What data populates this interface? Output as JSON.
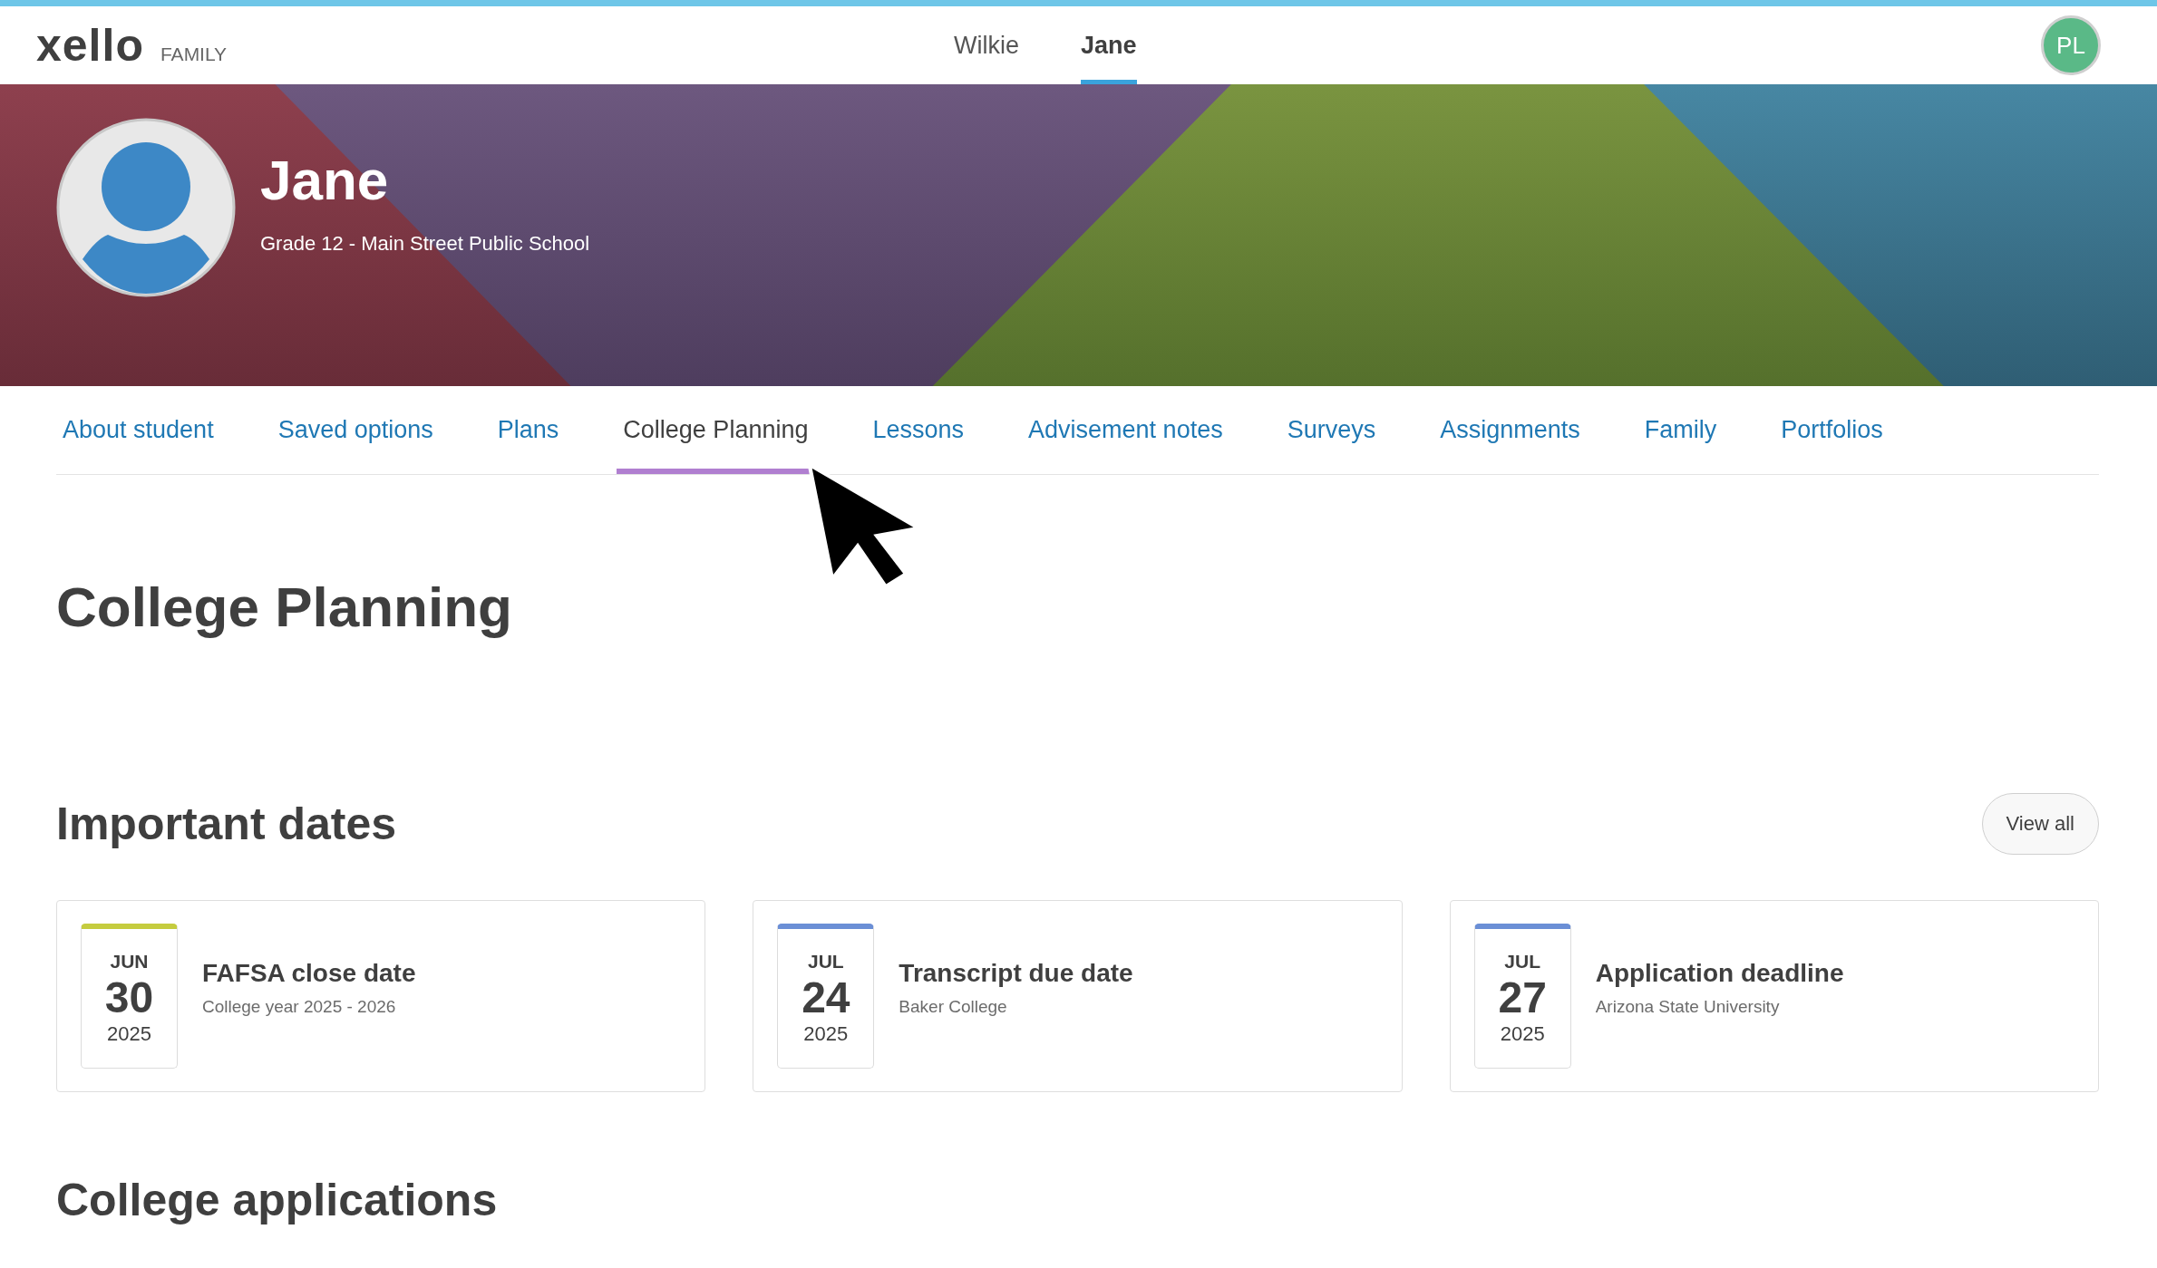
{
  "header": {
    "logo": "xello",
    "product": "FAMILY",
    "students": [
      {
        "name": "Wilkie",
        "selected": false
      },
      {
        "name": "Jane",
        "selected": true
      }
    ],
    "avatar_initials": "PL"
  },
  "profile": {
    "name": "Jane",
    "subtitle": "Grade 12 - Main Street Public School"
  },
  "tabs": [
    {
      "label": "About student",
      "selected": false
    },
    {
      "label": "Saved options",
      "selected": false
    },
    {
      "label": "Plans",
      "selected": false
    },
    {
      "label": "College Planning",
      "selected": true
    },
    {
      "label": "Lessons",
      "selected": false
    },
    {
      "label": "Advisement notes",
      "selected": false
    },
    {
      "label": "Surveys",
      "selected": false
    },
    {
      "label": "Assignments",
      "selected": false
    },
    {
      "label": "Family",
      "selected": false
    },
    {
      "label": "Portfolios",
      "selected": false
    }
  ],
  "page_title": "College Planning",
  "important_dates": {
    "title": "Important dates",
    "view_all": "View all",
    "items": [
      {
        "month": "JUN",
        "day": "30",
        "year": "2025",
        "color": "#c5cc3f",
        "title": "FAFSA close date",
        "subtitle": "College year 2025 - 2026"
      },
      {
        "month": "JUL",
        "day": "24",
        "year": "2025",
        "color": "#6b8fd6",
        "title": "Transcript due date",
        "subtitle": "Baker College"
      },
      {
        "month": "JUL",
        "day": "27",
        "year": "2025",
        "color": "#6b8fd6",
        "title": "Application deadline",
        "subtitle": "Arizona State University"
      }
    ]
  },
  "college_applications": {
    "title": "College applications"
  }
}
